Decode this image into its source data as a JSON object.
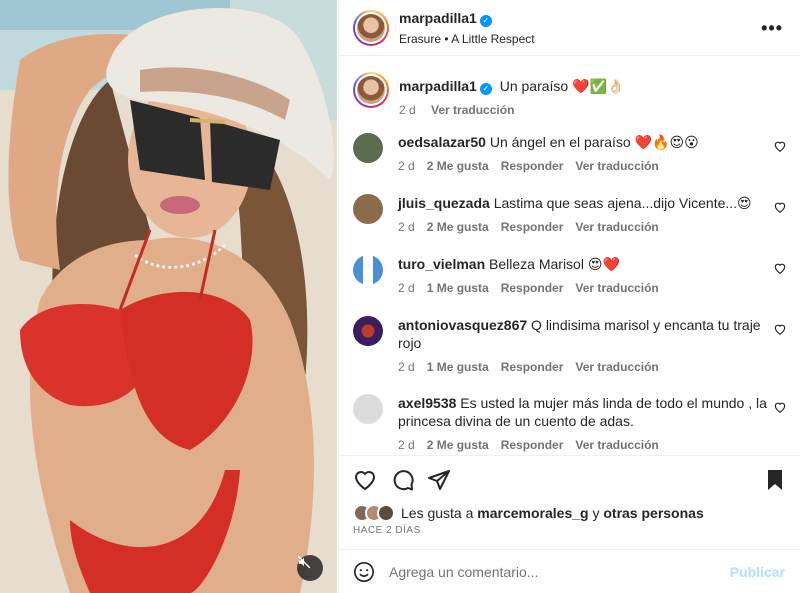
{
  "post": {
    "username": "marpadilla1",
    "audio": "Erasure • A Little Respect",
    "verified_mark": "✓",
    "more_label": "•••"
  },
  "caption": {
    "username": "marpadilla1",
    "text": "Un paraíso ❤️✅👌🏻",
    "time": "2 d",
    "translate": "Ver traducción"
  },
  "comments": [
    {
      "username": "oedsalazar50",
      "text": "Un ángel en el paraíso ❤️🔥😍😮",
      "time": "2 d",
      "likes": "2 Me gusta",
      "reply": "Responder",
      "translate": "Ver traducción",
      "avatar_color": "#5b6b4f"
    },
    {
      "username": "jluis_quezada",
      "text": "Lastima que seas ajena...dijo Vicente...😍",
      "time": "2 d",
      "likes": "2 Me gusta",
      "reply": "Responder",
      "translate": "Ver traducción",
      "avatar_color": "#8a6b4a"
    },
    {
      "username": "turo_vielman",
      "text": "Belleza Marisol 😍❤️",
      "time": "2 d",
      "likes": "1 Me gusta",
      "reply": "Responder",
      "translate": "Ver traducción",
      "avatar_color": "#4a90d9"
    },
    {
      "username": "antoniovasquez867",
      "text": "Q lindisima marisol y encanta tu traje rojo",
      "time": "2 d",
      "likes": "1 Me gusta",
      "reply": "Responder",
      "translate": "Ver traducción",
      "avatar_color": "#3a1f5c"
    },
    {
      "username": "axel9538",
      "text": "Es usted la mujer más linda de todo el mundo , la princesa divina de un cuento de adas.",
      "time": "2 d",
      "likes": "2 Me gusta",
      "reply": "Responder",
      "translate": "Ver traducción",
      "avatar_color": "#dbdbdb"
    }
  ],
  "likes_line": {
    "prefix": "Les gusta a",
    "user": "marcemorales_g",
    "joiner": "y",
    "others": "otras personas"
  },
  "timestamp": "HACE 2 DÍAS",
  "add_comment": {
    "placeholder": "Agrega un comentario...",
    "publish": "Publicar"
  }
}
